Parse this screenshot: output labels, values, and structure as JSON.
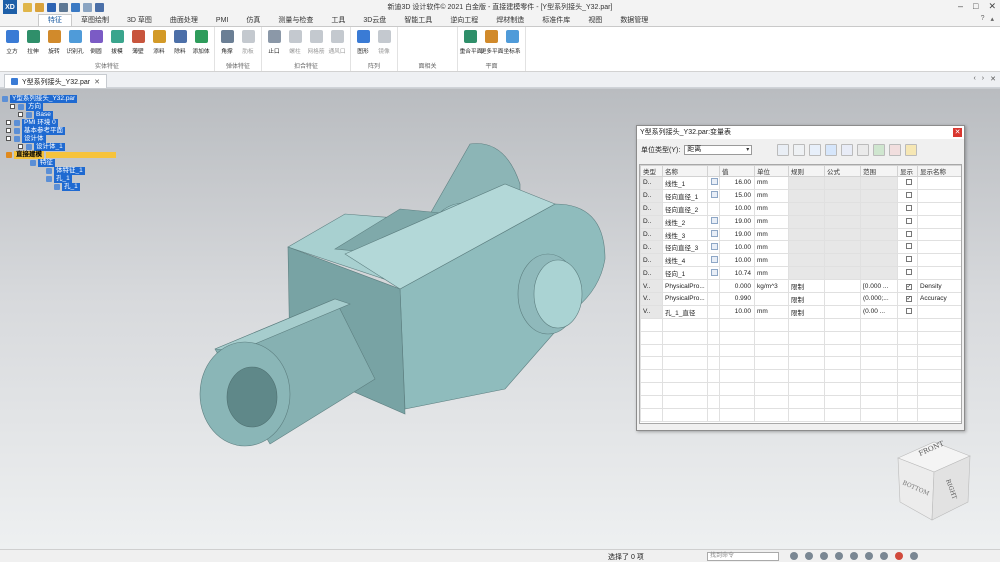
{
  "app": {
    "title": "新迪3D 设计软件© 2021 白金版 - 直接建模零件 - [Y型系列接头_Y32.par]",
    "logo": "XD"
  },
  "ribbon_tabs": [
    "特征",
    "草图绘制",
    "3D 草图",
    "曲面处理",
    "PMI",
    "仿真",
    "测量与检查",
    "工具",
    "3D云盘",
    "智能工具",
    "逆向工程",
    "焊材制造",
    "标准件库",
    "视图",
    "数据管理"
  ],
  "ribbon_groups": [
    {
      "label": "实体特征",
      "buttons": [
        "立方",
        "拉伸",
        "旋转",
        "识别孔",
        "倒圆",
        "拔模",
        "薄壁",
        "添料",
        "除料",
        "添加体"
      ]
    },
    {
      "label": "弹体特征",
      "buttons": [
        "角撑",
        "肋板"
      ]
    },
    {
      "label": "扣合特征",
      "buttons": [
        "止口",
        "螺柱",
        "网格筋",
        "通风口"
      ]
    },
    {
      "label": "阵列",
      "buttons": [
        "图形",
        "镜像"
      ]
    },
    {
      "label": "面相关",
      "buttons": []
    },
    {
      "label": "平面",
      "buttons": [
        "重合平面",
        "更多平面",
        "坐标系"
      ]
    }
  ],
  "document": {
    "tab_label": "Y型系列接头_Y32.par"
  },
  "tree": [
    {
      "label": "Y型系列接头_Y32.par",
      "style": "sel"
    },
    {
      "label": "方向",
      "style": "sel"
    },
    {
      "label": "Base",
      "style": "sel"
    },
    {
      "label": "PMI 环境 0",
      "style": "sel"
    },
    {
      "label": "基本参考平面",
      "style": "sel"
    },
    {
      "label": "设计体",
      "style": "sel"
    },
    {
      "label": "设计体_1",
      "style": "sel"
    },
    {
      "label": "直接建模",
      "style": "hl"
    },
    {
      "label": "特征",
      "style": "sel"
    },
    {
      "label": "体特征_1",
      "style": "sel"
    },
    {
      "label": "孔_1",
      "style": "sel"
    },
    {
      "label": "孔_1",
      "style": "sel"
    }
  ],
  "dialog": {
    "title": "Y型系列接头_Y32.par:变量表",
    "unit_type_label": "单位类型(Y):",
    "unit_type_value": "距离",
    "columns": [
      "类型",
      "名称",
      "",
      "值",
      "单位",
      "规则",
      "公式",
      "范围",
      "显示",
      "显示名称"
    ],
    "rows": [
      {
        "type": "D..",
        "name": "线性_1",
        "fx": true,
        "value": "16.00",
        "unit": "mm",
        "rule": "",
        "formula": "",
        "range": "",
        "show": false,
        "display": ""
      },
      {
        "type": "D..",
        "name": "径向直径_1",
        "fx": true,
        "value": "15.00",
        "unit": "mm",
        "rule": "",
        "formula": "",
        "range": "",
        "show": false,
        "display": ""
      },
      {
        "type": "D..",
        "name": "径向直径_2",
        "fx": false,
        "value": "10.00",
        "unit": "mm",
        "rule": "",
        "formula": "",
        "range": "",
        "show": false,
        "display": ""
      },
      {
        "type": "D..",
        "name": "线性_2",
        "fx": true,
        "value": "19.00",
        "unit": "mm",
        "rule": "",
        "formula": "",
        "range": "",
        "show": false,
        "display": ""
      },
      {
        "type": "D..",
        "name": "线性_3",
        "fx": true,
        "value": "19.00",
        "unit": "mm",
        "rule": "",
        "formula": "",
        "range": "",
        "show": false,
        "display": ""
      },
      {
        "type": "D..",
        "name": "径向直径_3",
        "fx": true,
        "value": "10.00",
        "unit": "mm",
        "rule": "",
        "formula": "",
        "range": "",
        "show": false,
        "display": ""
      },
      {
        "type": "D..",
        "name": "线性_4",
        "fx": true,
        "value": "10.00",
        "unit": "mm",
        "rule": "",
        "formula": "",
        "range": "",
        "show": false,
        "display": ""
      },
      {
        "type": "D..",
        "name": "径向_1",
        "fx": true,
        "value": "10.74",
        "unit": "mm",
        "rule": "",
        "formula": "",
        "range": "",
        "show": false,
        "display": ""
      },
      {
        "type": "V..",
        "name": "PhysicalPro...",
        "fx": false,
        "value": "0.000",
        "unit": "kg/m^3",
        "rule": "限制",
        "formula": "",
        "range": "[0.000 ...",
        "show": true,
        "display": "Density"
      },
      {
        "type": "V..",
        "name": "PhysicalPro...",
        "fx": false,
        "value": "0.990",
        "unit": "",
        "rule": "限制",
        "formula": "",
        "range": "(0.000;...",
        "show": true,
        "display": "Accuracy"
      },
      {
        "type": "V..",
        "name": "孔_1_直径",
        "fx": false,
        "value": "10.00",
        "unit": "mm",
        "rule": "限制",
        "formula": "",
        "range": "(0.00 ...",
        "show": false,
        "display": ""
      }
    ]
  },
  "status": {
    "message": "选择了 0 项",
    "command_placeholder": "找到命令"
  },
  "viewcube": {
    "front": "FRONT",
    "right": "RIGHT",
    "bottom": "BOTTOM"
  },
  "colors": {
    "accent": "#1a5aa0",
    "part_body": "#8fb9b9",
    "highlight": "#f6c33c",
    "selection": "#1f6ad1"
  }
}
